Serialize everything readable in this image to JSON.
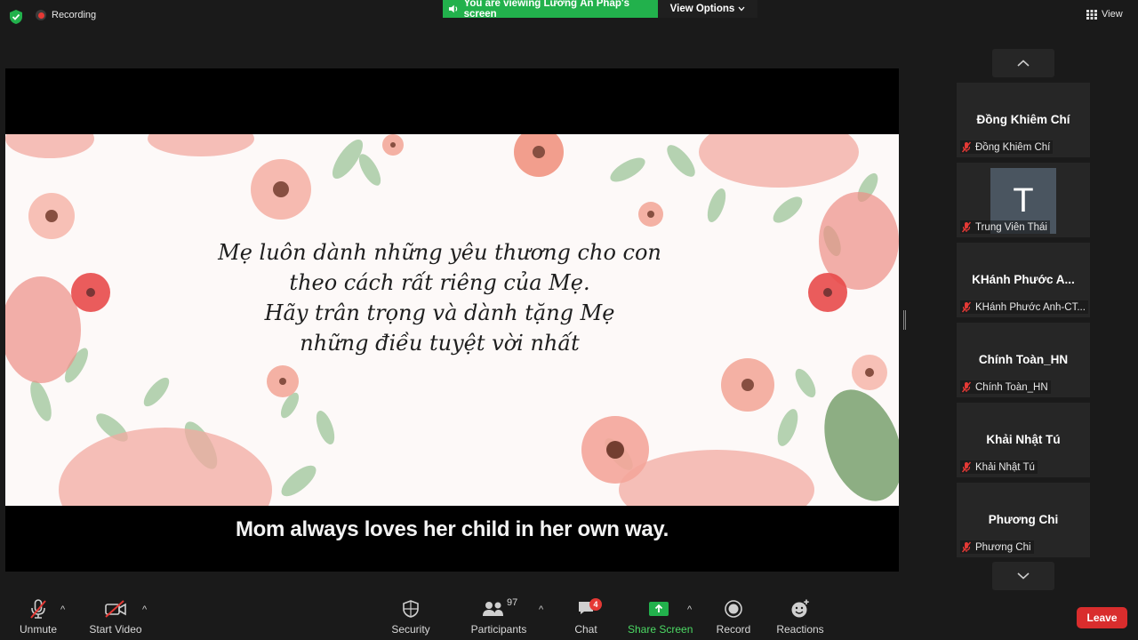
{
  "top": {
    "recording": "Recording",
    "viewing": "You are viewing Lương Ấn Pháp's screen",
    "view_options": "View Options",
    "view": "View"
  },
  "share": {
    "poem": [
      "Mẹ luôn dành những yêu thương cho con",
      "theo cách rất riêng của Mẹ.",
      "Hãy trân trọng và dành tặng Mẹ",
      "những điều tuyệt vời nhất"
    ],
    "subtitle": "Mom always loves her child in her own way."
  },
  "participants": [
    {
      "display": "Đồng Khiêm Chí",
      "label": "Đồng Khiêm Chí",
      "muted": true
    },
    {
      "display": "T",
      "label": "Trung Viên Thái",
      "muted": true,
      "avatar": true
    },
    {
      "display": "KHánh Phước A...",
      "label": "KHánh Phước Anh-CT...",
      "muted": true
    },
    {
      "display": "Chính Toàn_HN",
      "label": "Chính Toàn_HN",
      "muted": true
    },
    {
      "display": "Khải Nhật Tú",
      "label": "Khải Nhật Tú",
      "muted": true
    },
    {
      "display": "Phương Chi",
      "label": "Phương Chi",
      "muted": true
    }
  ],
  "toolbar": {
    "unmute": "Unmute",
    "start_video": "Start Video",
    "security": "Security",
    "participants": "Participants",
    "participants_count": "97",
    "chat": "Chat",
    "chat_badge": "4",
    "share_screen": "Share Screen",
    "record": "Record",
    "reactions": "Reactions",
    "leave": "Leave"
  },
  "colors": {
    "green": "#22b14c",
    "leave_red": "#d92d2d",
    "mute_red": "#e53935",
    "background": "#1a1a1a"
  },
  "icons": [
    "shield-icon",
    "recording-dot-icon",
    "sound-icon",
    "chevron-down-icon",
    "grid-icon",
    "chevron-up-icon",
    "mic-muted-icon",
    "video-off-icon",
    "security-icon",
    "participants-icon",
    "chat-icon",
    "share-screen-icon",
    "record-icon",
    "reactions-icon"
  ]
}
